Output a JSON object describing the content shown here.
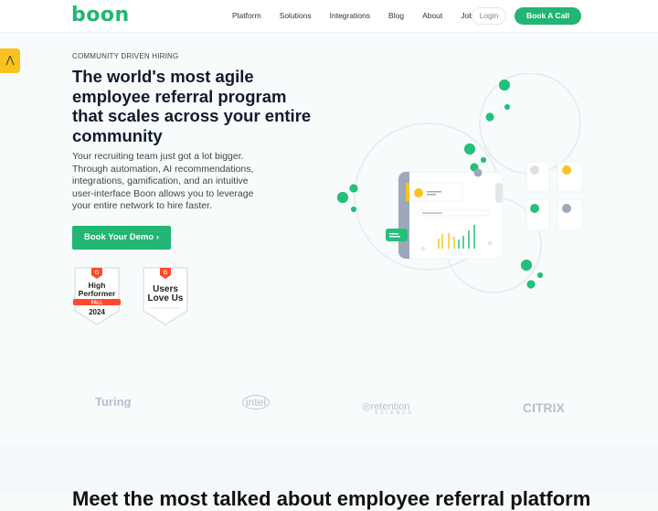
{
  "nav": {
    "logo": "boon",
    "links": [
      "Platform",
      "Solutions",
      "Integrations",
      "Blog",
      "About",
      "Jobs"
    ],
    "login": "Login",
    "book_call": "Book A Call"
  },
  "hero": {
    "eyebrow": "COMMUNITY DRIVEN HIRING",
    "title": "The world's most agile employee referral program that scales across your entire community",
    "subtitle": "Your recruiting team just got a lot bigger. Through automation, AI recommendations, integrations, gamification, and an intuitive user-interface Boon allows you to leverage your entire network to hire faster.",
    "cta": "Book Your Demo"
  },
  "badges": [
    {
      "brand": "G",
      "line1": "High",
      "line2": "Performer",
      "ribbon": "FALL",
      "year": "2024"
    },
    {
      "brand": "G",
      "line1": "Users",
      "line2": "Love Us"
    }
  ],
  "logos": [
    "Turing",
    "intel",
    "retention",
    "CITRIX"
  ],
  "logo_sub": "SCIENCE",
  "section": {
    "heading": "Meet the most talked about employee referral platform"
  },
  "colors": {
    "brand": "#22b573",
    "accent": "#f9c31f",
    "badge_red": "#ff492c"
  }
}
